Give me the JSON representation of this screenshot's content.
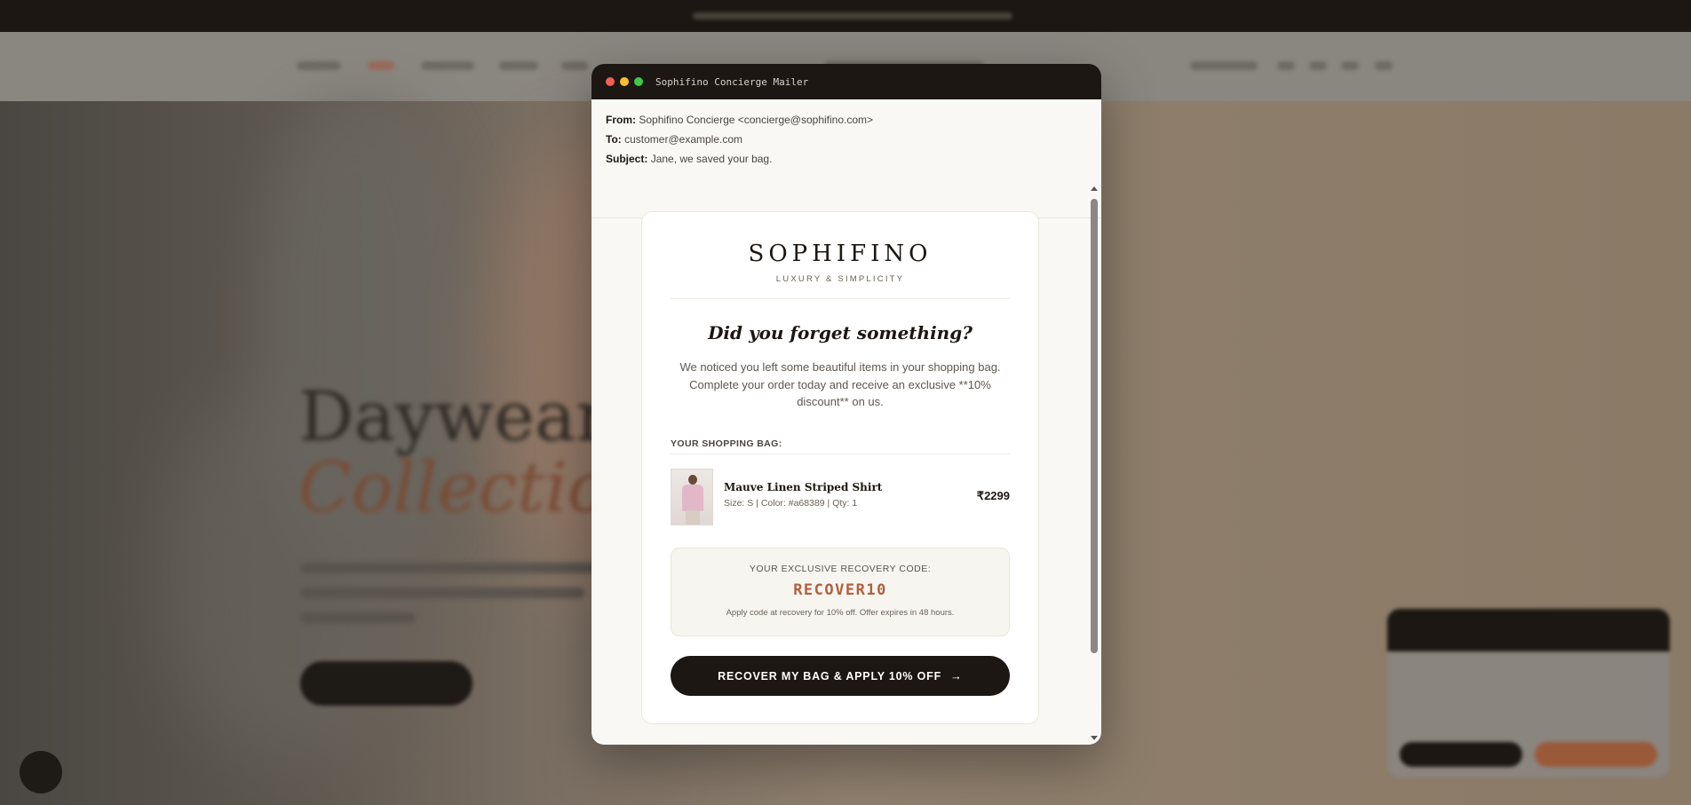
{
  "window": {
    "title": "Sophifino Concierge Mailer"
  },
  "email": {
    "from_label": "From:",
    "from_value": "Sophifino Concierge <concierge@sophifino.com>",
    "to_label": "To:",
    "to_value": "customer@example.com",
    "subject_label": "Subject:",
    "subject_value": "Jane, we saved your bag."
  },
  "message": {
    "brand": "SOPHIFINO",
    "tagline": "LUXURY & SIMPLICITY",
    "headline": "Did you forget something?",
    "intro": "We noticed you left some beautiful items in your shopping bag. Complete your order today and receive an exclusive **10% discount** on us.",
    "bag_label": "YOUR SHOPPING BAG:",
    "items": [
      {
        "name": "Mauve Linen Striped Shirt",
        "meta": "Size: S | Color: #a68389 | Qty: 1",
        "price": "₹2299"
      }
    ],
    "code_label": "YOUR EXCLUSIVE RECOVERY CODE:",
    "code_value": "RECOVER10",
    "code_note": "Apply code at recovery for 10% off. Offer expires in 48 hours.",
    "cta_label": "RECOVER MY BAG & APPLY 10% OFF",
    "cta_icon": "arrow-right-icon"
  },
  "colors": {
    "dark": "#1c1712",
    "accent": "#b0603e",
    "window_bg": "#faf8f5"
  }
}
